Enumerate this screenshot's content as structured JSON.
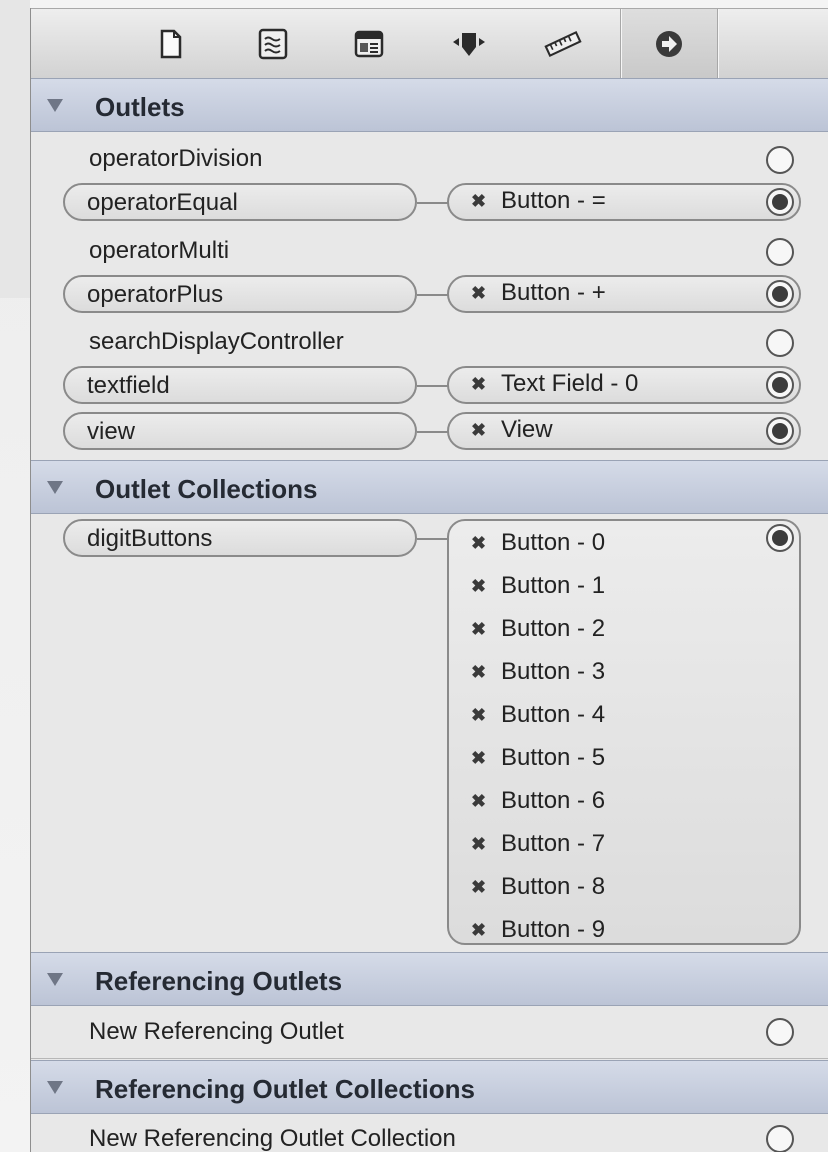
{
  "toolbar": {
    "icons": [
      "file-icon",
      "quick-help-icon",
      "identity-icon",
      "attributes-icon",
      "size-ruler-icon",
      "connections-arrow-icon"
    ]
  },
  "outlets": {
    "title": "Outlets",
    "items": [
      {
        "name": "operatorDivision",
        "target": ""
      },
      {
        "name": "operatorEqual",
        "target": "Button - ="
      },
      {
        "name": "operatorMulti",
        "target": ""
      },
      {
        "name": "operatorPlus",
        "target": "Button - +"
      },
      {
        "name": "searchDisplayController",
        "target": ""
      },
      {
        "name": "textfield",
        "target": "Text Field - 0"
      },
      {
        "name": "view",
        "target": "View"
      }
    ]
  },
  "outlet_collections": {
    "title": "Outlet Collections",
    "name": "digitButtons",
    "targets": [
      "Button - 0",
      "Button - 1",
      "Button - 2",
      "Button - 3",
      "Button - 4",
      "Button - 5",
      "Button - 6",
      "Button - 7",
      "Button - 8",
      "Button - 9"
    ]
  },
  "referencing_outlets": {
    "title": "Referencing Outlets",
    "item": "New Referencing Outlet"
  },
  "referencing_outlet_collections": {
    "title": "Referencing Outlet Collections",
    "item": "New Referencing Outlet Collection"
  },
  "x_glyph": "✖"
}
